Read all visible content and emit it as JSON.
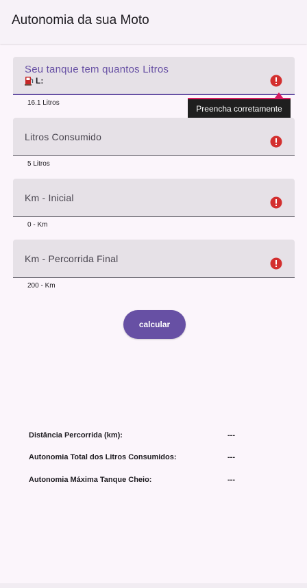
{
  "app": {
    "title": "Autonomia da sua Moto"
  },
  "fields": [
    {
      "label": "Seu tanque tem quantos Litros",
      "prefix": "L:",
      "helper": "16.1 Litros",
      "icon": "error-icon",
      "focused": true
    },
    {
      "label": "Litros Consumido",
      "helper": "5 Litros",
      "icon": "error-icon"
    },
    {
      "label": "Km - Inicial",
      "helper": "0 - Km",
      "icon": "error-icon"
    },
    {
      "label": "Km - Percorrida Final",
      "helper": "200 - Km",
      "icon": "error-icon"
    }
  ],
  "tooltip": {
    "text": "Preencha corretamente"
  },
  "button": {
    "label": "calcular"
  },
  "results": [
    {
      "label": "Distância Percorrida (km):",
      "value": "---"
    },
    {
      "label": "Autonomia Total dos Litros Consumidos:",
      "value": "---"
    },
    {
      "label": "Autonomia Máxima Tanque Cheio:",
      "value": "---"
    }
  ],
  "colors": {
    "accent": "#6750a4",
    "error": "#d32f2f",
    "tooltip_bg": "#1f1f1f"
  }
}
